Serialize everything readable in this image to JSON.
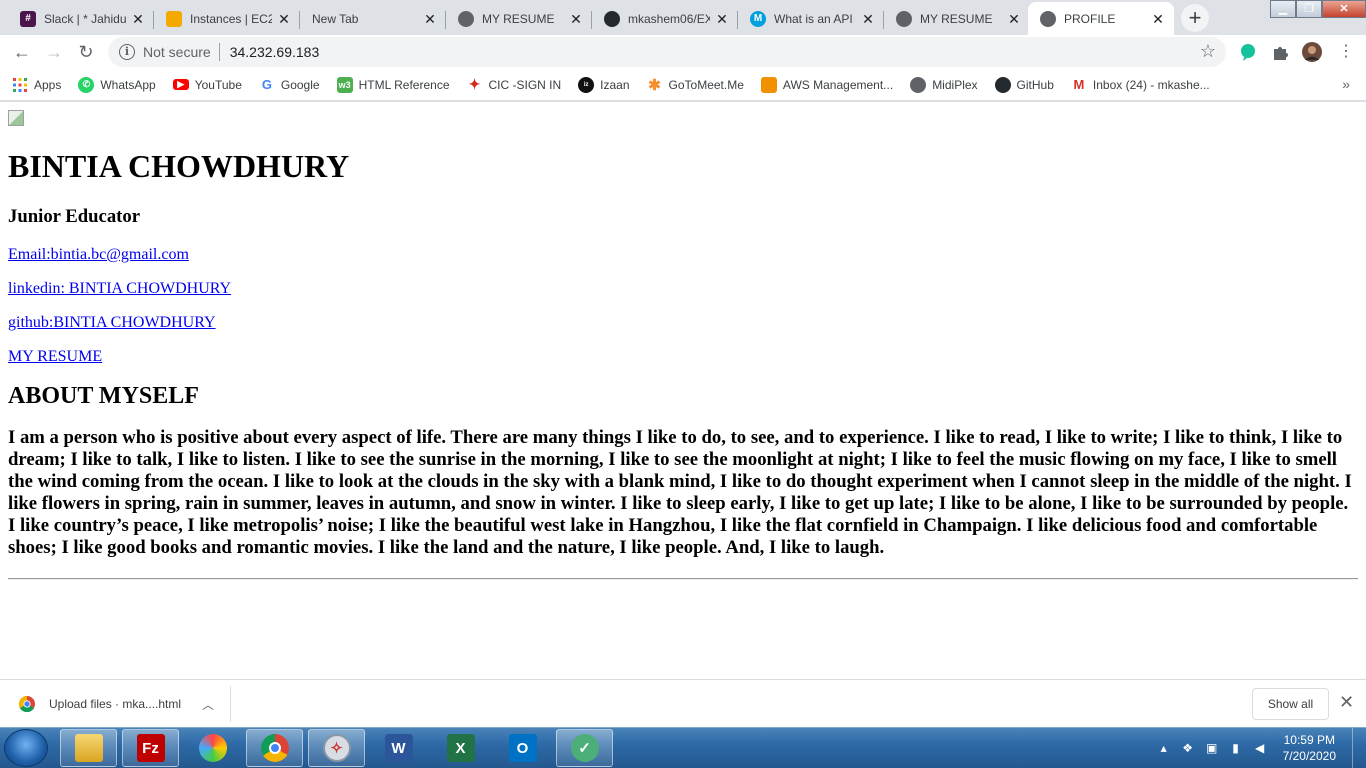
{
  "tabs": [
    {
      "title": "Slack | * Jahidul",
      "favicon": "slack-icon",
      "color": "#4a154b",
      "active": false
    },
    {
      "title": "Instances | EC2",
      "favicon": "aws-cube-icon",
      "color": "#f2a900",
      "active": false
    },
    {
      "title": "New Tab",
      "favicon": "",
      "color": "",
      "active": false
    },
    {
      "title": "MY RESUME",
      "favicon": "globe-icon",
      "color": "#5f6368",
      "active": false
    },
    {
      "title": "mkashem06/EX",
      "favicon": "github-icon",
      "color": "#24292e",
      "active": false
    },
    {
      "title": "What is an API",
      "favicon": "mulesoft-icon",
      "color": "#00a0df",
      "active": false
    },
    {
      "title": "MY RESUME",
      "favicon": "globe-icon",
      "color": "#5f6368",
      "active": false
    },
    {
      "title": "PROFILE",
      "favicon": "globe-icon",
      "color": "#5f6368",
      "active": true
    }
  ],
  "toolbar": {
    "security_label": "Not secure",
    "url": "34.232.69.183"
  },
  "bookmarks": [
    {
      "label": "Apps",
      "icon": "apps-grid-icon",
      "color": "#e8453c"
    },
    {
      "label": "WhatsApp",
      "icon": "whatsapp-icon",
      "color": "#25d366"
    },
    {
      "label": "YouTube",
      "icon": "youtube-icon",
      "color": "#ff0000"
    },
    {
      "label": "Google",
      "icon": "google-icon",
      "color": "#4285f4"
    },
    {
      "label": "HTML Reference",
      "icon": "w3-icon",
      "color": "#4caf50"
    },
    {
      "label": "CIC -SIGN IN",
      "icon": "maple-leaf-icon",
      "color": "#d52b1e"
    },
    {
      "label": "Izaan",
      "icon": "izaan-icon",
      "color": "#111111"
    },
    {
      "label": "GoToMeet.Me",
      "icon": "gotomeeting-icon",
      "color": "#f68d2e"
    },
    {
      "label": "AWS Management...",
      "icon": "aws-cube-icon",
      "color": "#f29100"
    },
    {
      "label": "MidiPlex",
      "icon": "globe-icon",
      "color": "#5f6368"
    },
    {
      "label": "GitHub",
      "icon": "github-icon",
      "color": "#24292e"
    },
    {
      "label": "Inbox (24) - mkashe...",
      "icon": "gmail-icon",
      "color": "#d93025"
    }
  ],
  "page": {
    "name": "BINTIA CHOWDHURY",
    "role": "Junior Educator",
    "links": {
      "email": "Email:bintia.bc@gmail.com",
      "linkedin": "linkedin: BINTIA CHOWDHURY",
      "github": "github:BINTIA CHOWDHURY",
      "resume": "MY RESUME"
    },
    "about_heading": "ABOUT MYSELF",
    "about_text": "I am a person who is positive about every aspect of life. There are many things I like to do, to see, and to experience. I like to read, I like to write; I like to think, I like to dream; I like to talk, I like to listen. I like to see the sunrise in the morning, I like to see the moonlight at night; I like to feel the music flowing on my face, I like to smell the wind coming from the ocean. I like to look at the clouds in the sky with a blank mind, I like to do thought experiment when I cannot sleep in the middle of the night. I like flowers in spring, rain in summer, leaves in autumn, and snow in winter. I like to sleep early, I like to get up late; I like to be alone, I like to be surrounded by people. I like country’s peace, I like metropolis’ noise; I like the beautiful west lake in Hangzhou, I like the flat cornfield in Champaign. I like delicious food and comfortable shoes; I like good books and romantic movies. I like the land and the nature, I like people. And, I like to laugh."
  },
  "download_bar": {
    "file_label": "Upload files · mka....html",
    "show_all_label": "Show all"
  },
  "taskbar": {
    "time": "10:59 PM",
    "date": "7/20/2020"
  }
}
